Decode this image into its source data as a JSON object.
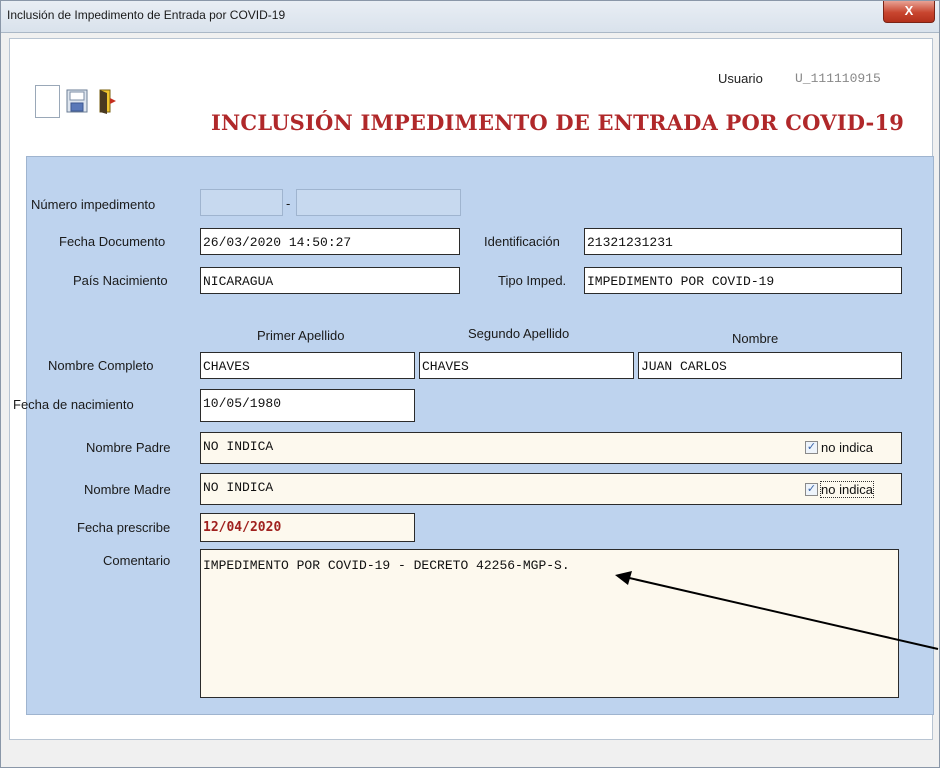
{
  "window": {
    "title": "Inclusión de Impedimento de Entrada por COVID-19",
    "close_glyph": "X"
  },
  "toolbar": {
    "icons": [
      "blank-icon",
      "save-icon",
      "exit-icon"
    ]
  },
  "header": {
    "user_label": "Usuario",
    "user_value": "U_111110915",
    "heading": "INCLUSIÓN IMPEDIMENTO DE ENTRADA POR COVID-19"
  },
  "form": {
    "numero_label": "Número impedimento",
    "numero_sep": "-",
    "fecha_doc_label": "Fecha Documento",
    "fecha_doc_value": "26/03/2020 14:50:27",
    "identificacion_label": "Identificación",
    "identificacion_value": "21321231231",
    "pais_label": "País Nacimiento",
    "pais_value": "NICARAGUA",
    "tipo_label": "Tipo Imped.",
    "tipo_value": "IMPEDIMENTO POR COVID-19",
    "col_primer": "Primer Apellido",
    "col_segundo": "Segundo Apellido",
    "col_nombre": "Nombre",
    "nombre_completo_label": "Nombre Completo",
    "primer_apellido": "CHAVES",
    "segundo_apellido": "CHAVES",
    "nombre": "JUAN CARLOS",
    "fecha_nac_label": "Fecha de nacimiento",
    "fecha_nac_value": "10/05/1980",
    "padre_label": "Nombre Padre",
    "padre_value": "NO INDICA",
    "padre_check_label": "no indica",
    "madre_label": "Nombre Madre",
    "madre_value": "NO INDICA",
    "madre_check_label": "no indica",
    "prescribe_label": "Fecha prescribe",
    "prescribe_value": "12/04/2020",
    "comentario_label": "Comentario",
    "comentario_value": "IMPEDIMENTO POR COVID-19 - DECRETO 42256-MGP-S."
  },
  "colors": {
    "panel": "#bed3ee",
    "heading": "#b0282a",
    "prescribe": "#a0211e"
  }
}
